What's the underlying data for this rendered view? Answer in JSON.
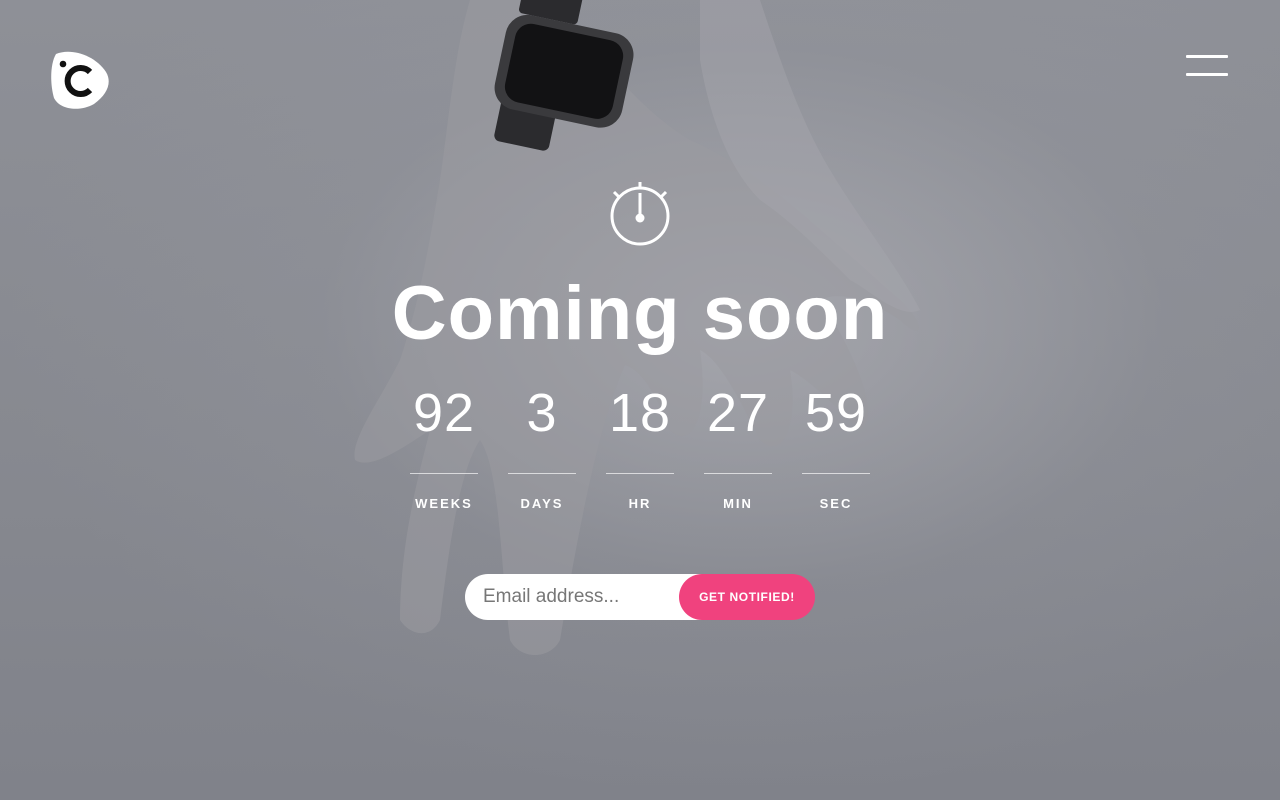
{
  "header": {
    "logo_icon": "c-logo-icon",
    "menu_icon": "hamburger-menu-icon"
  },
  "hero": {
    "timer_icon": "stopwatch-icon",
    "title": "Coming soon"
  },
  "countdown": {
    "units": [
      {
        "value": "92",
        "label": "WEEKS"
      },
      {
        "value": "3",
        "label": "DAYS"
      },
      {
        "value": "18",
        "label": "HR"
      },
      {
        "value": "27",
        "label": "MIN"
      },
      {
        "value": "59",
        "label": "SEC"
      }
    ]
  },
  "subscribe": {
    "email_placeholder": "Email address...",
    "button_label": "GET NOTIFIED!"
  },
  "colors": {
    "accent": "#f0427e",
    "text": "#ffffff",
    "background": "#8a8c93"
  }
}
